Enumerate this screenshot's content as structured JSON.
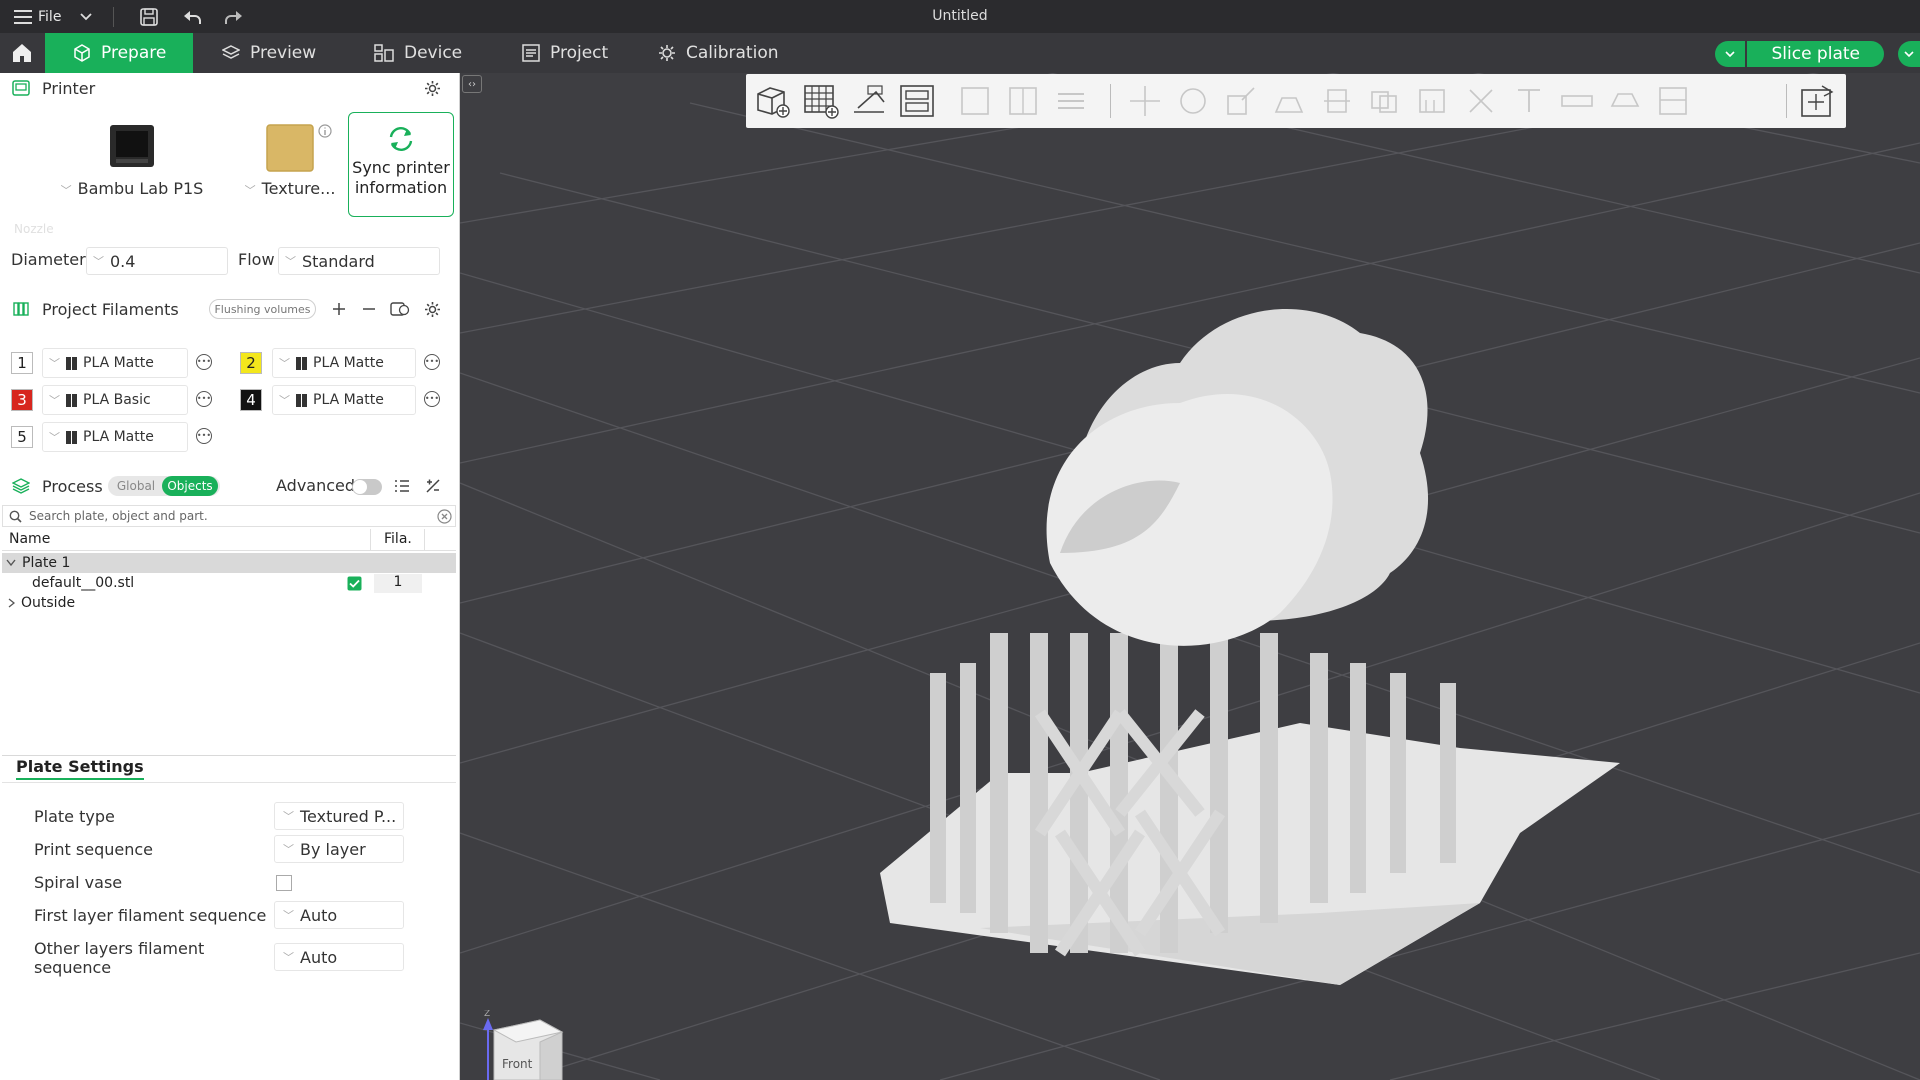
{
  "titlebar": {
    "file_label": "File",
    "title": "Untitled"
  },
  "tabs": [
    {
      "label": "Prepare",
      "icon": "cube-icon"
    },
    {
      "label": "Preview",
      "icon": "layers-icon"
    },
    {
      "label": "Device",
      "icon": "device-icon"
    },
    {
      "label": "Project",
      "icon": "project-icon"
    },
    {
      "label": "Calibration",
      "icon": "calibration-icon"
    }
  ],
  "slice_button": "Slice plate",
  "printer": {
    "section_label": "Printer",
    "printer_name": "Bambu Lab P1S",
    "plate_name": "Texture...",
    "sync_label_1": "Sync printer",
    "sync_label_2": "information",
    "nozzle_label": "Nozzle",
    "diameter_label": "Diameter",
    "diameter_value": "0.4",
    "flow_label": "Flow",
    "flow_value": "Standard"
  },
  "filaments": {
    "section_label": "Project Filaments",
    "flushing_label": "Flushing volumes",
    "items": [
      {
        "num": "1",
        "name": "PLA Matte",
        "color": "#ffffff",
        "text_color": "#222222"
      },
      {
        "num": "2",
        "name": "PLA Matte",
        "color": "#f3e71c",
        "text_color": "#222222"
      },
      {
        "num": "3",
        "name": "PLA Basic",
        "color": "#d7261e",
        "text_color": "#ffffff"
      },
      {
        "num": "4",
        "name": "PLA Matte",
        "color": "#111111",
        "text_color": "#ffffff"
      },
      {
        "num": "5",
        "name": "PLA Matte",
        "color": "#ffffff",
        "text_color": "#222222"
      }
    ]
  },
  "process": {
    "section_label": "Process",
    "global_label": "Global",
    "objects_label": "Objects",
    "advanced_label": "Advanced",
    "search_placeholder": "Search plate, object and part.",
    "col_name": "Name",
    "col_fila": "Fila.",
    "rows": [
      {
        "label": "Plate 1"
      },
      {
        "label": "default__00.stl",
        "fila": "1"
      },
      {
        "label": "Outside"
      }
    ]
  },
  "plate_settings": {
    "tab_label": "Plate Settings",
    "plate_type_label": "Plate type",
    "plate_type_value": "Textured P...",
    "print_sequence_label": "Print sequence",
    "print_sequence_value": "By layer",
    "spiral_vase_label": "Spiral vase",
    "first_layer_label": "First layer filament sequence",
    "first_layer_value": "Auto",
    "other_layers_label_1": "Other layers filament",
    "other_layers_label_2": "sequence",
    "other_layers_value": "Auto"
  },
  "viewport": {
    "axis_label": "Z",
    "cube_label": "Front"
  },
  "colors": {
    "accent": "#19b05a",
    "dark_bar": "#2b2b2e",
    "viewport_bg": "#3e3e42"
  }
}
